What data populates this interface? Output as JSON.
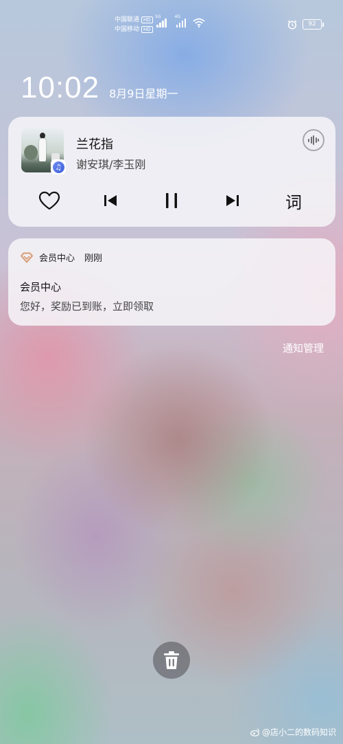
{
  "status_bar": {
    "carrier_1": "中国联通",
    "carrier_2": "中国移动",
    "hd_label": "HD",
    "network_1": "5G",
    "network_2": "4G",
    "battery": "92"
  },
  "lock": {
    "time": "10:02",
    "date": "8月9日星期一"
  },
  "music": {
    "title": "兰花指",
    "artist": "谢安琪/李玉刚",
    "lyrics_label": "词"
  },
  "notification": {
    "app_name": "会员中心",
    "time": "刚刚",
    "title": "会员中心",
    "body": "您好，奖励已到账，立即领取"
  },
  "notification_manage_label": "通知管理",
  "watermark": "@店小二的数码知识",
  "colors": {
    "card_bg": "#f6f4f8",
    "vip_icon": "#d89a72",
    "trash_bg": "#5a5a5f"
  }
}
